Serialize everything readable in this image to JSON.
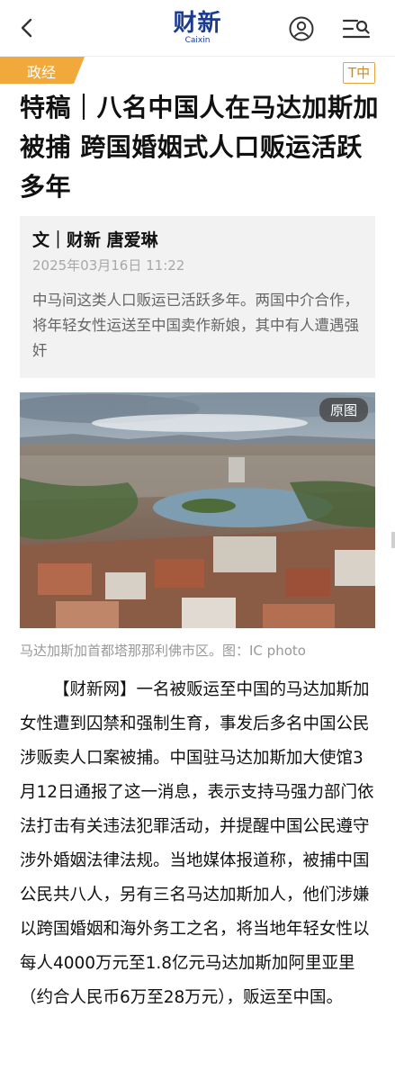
{
  "header": {
    "logo_cn": "财新",
    "logo_en": "Caixin"
  },
  "category": {
    "label": "政经",
    "color": "#f2a93b"
  },
  "font_toggle": "T中",
  "article": {
    "title": "特稿｜八名中国人在马达加斯加被捕 跨国婚姻式人口贩运活跃多年",
    "author": "文｜财新 唐爱琳",
    "date": "2025年03月16日 11:22",
    "summary": "中马间这类人口贩运已活跃多年。两国中介合作，将年轻女性运送至中国卖作新娘，其中有人遭遇强奸",
    "photo_button": "原图",
    "photo_caption": "马达加斯加首都塔那那利佛市区。图：IC photo",
    "body": "【财新网】一名被贩运至中国的马达加斯加女性遭到囚禁和强制生育，事发后多名中国公民涉贩卖人口案被捕。中国驻马达加斯加大使馆3月12日通报了这一消息，表示支持马强力部门依法打击有关违法犯罪活动，并提醒中国公民遵守涉外婚姻法律法规。当地媒体报道称，被捕中国公民共八人，另有三名马达加斯加人，他们涉嫌以跨国婚姻和海外务工之名，将当地年轻女性以每人4000万元至1.8亿元马达加斯加阿里亚里（约合人民币6万至28万元），贩运至中国。"
  },
  "icons": {
    "back": "chevron-left-icon",
    "user": "user-circle-icon",
    "menu": "menu-search-icon"
  },
  "colors": {
    "brand": "#1c3b8f",
    "accent": "#f2a93b"
  }
}
